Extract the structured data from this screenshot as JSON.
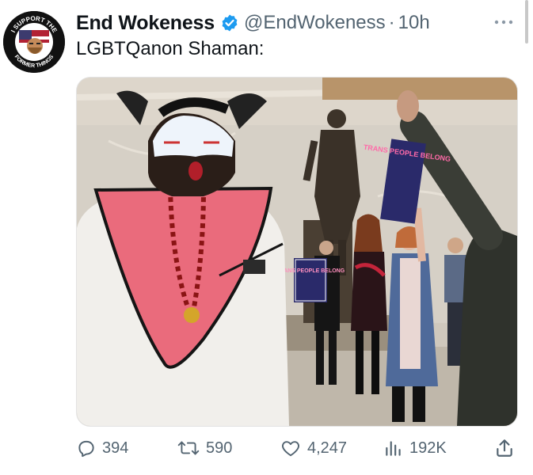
{
  "account": {
    "display_name": "End Wokeness",
    "handle": "@EndWokeness",
    "separator": "·",
    "timestamp": "10h",
    "avatar_top_text": "I SUPPORT THE",
    "avatar_bottom_text": "FORMER THINGS"
  },
  "tweet": {
    "text": "LGBTQanon Shaman:"
  },
  "media": {
    "protest_sign_text": "TRANS PEOPLE BELONG",
    "small_sign_text": "TRANS PEOPLE BELONG"
  },
  "metrics": {
    "replies": "394",
    "retweets": "590",
    "likes": "4,247",
    "views": "192K"
  },
  "colors": {
    "verified_badge": "#1d9bf0",
    "muted_text": "#536471"
  },
  "icons": [
    "verified-badge-icon",
    "more-options-icon",
    "reply-icon",
    "retweet-icon",
    "like-icon",
    "views-icon",
    "share-icon"
  ]
}
